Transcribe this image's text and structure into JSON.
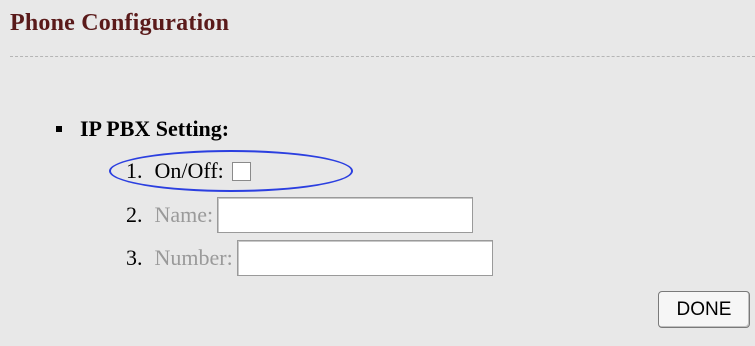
{
  "page": {
    "title": "Phone Configuration"
  },
  "section": {
    "heading": "IP PBX Setting:",
    "items": [
      {
        "number": "1.",
        "label": "On/Off:",
        "type": "checkbox",
        "checked": false,
        "enabled": true
      },
      {
        "number": "2.",
        "label": "Name:",
        "type": "text",
        "value": "",
        "enabled": false
      },
      {
        "number": "3.",
        "label": "Number:",
        "type": "text",
        "value": "",
        "enabled": false
      }
    ]
  },
  "actions": {
    "done_label": "DONE"
  },
  "colors": {
    "title": "#5a1a1a",
    "highlight_ellipse": "#2b3fe0",
    "disabled_text": "#9a9a9a",
    "background": "#e8e8e8"
  }
}
